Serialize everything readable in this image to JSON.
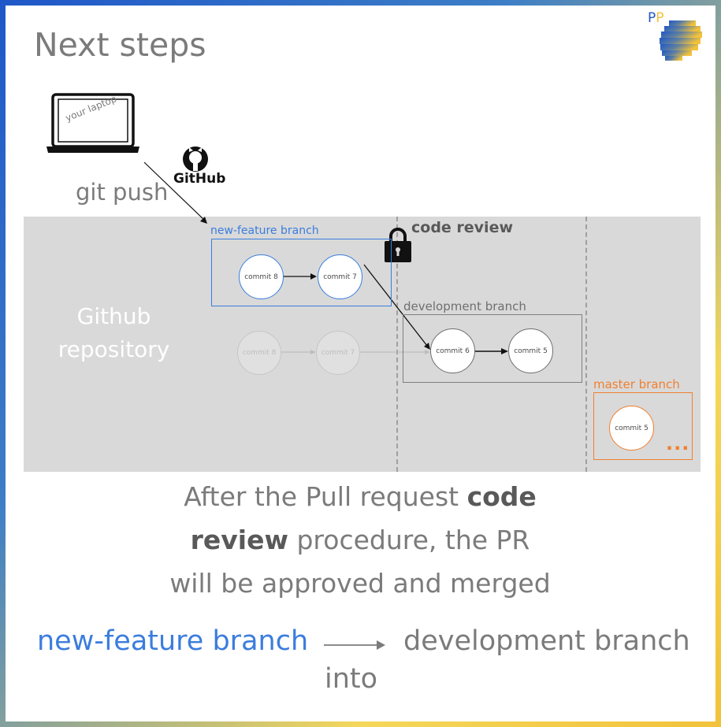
{
  "title": "Next steps",
  "logo": {
    "letters_1": "P",
    "letters_2": "P"
  },
  "laptop": {
    "label": "your laptop"
  },
  "push": {
    "label": "git push",
    "github_label": "GitHub"
  },
  "repo": {
    "label_line1": "Github",
    "label_line2": "repository",
    "code_review_label": "code review"
  },
  "branches": {
    "new_feature": {
      "label": "new-feature branch",
      "commits": [
        "commit 8",
        "commit 7"
      ]
    },
    "ghost": {
      "commits": [
        "commit 8",
        "commit 7"
      ]
    },
    "development": {
      "label": "development branch",
      "commits": [
        "commit 6",
        "commit 5"
      ]
    },
    "master": {
      "label": "master branch",
      "commits": [
        "commit 5"
      ],
      "ellipsis": "..."
    }
  },
  "description": {
    "part1": "After the Pull request ",
    "bold1": "code",
    "bold2": "review",
    "part2": " procedure, the PR",
    "line3": "will be approved and merged"
  },
  "merge": {
    "source": "new-feature branch",
    "target": "development branch",
    "connector": "into"
  },
  "colors": {
    "blue": "#3b7ddd",
    "orange": "#f07f30",
    "gray_text": "#7b7b7b",
    "repo_bg": "#d9d9d9",
    "frame_blue": "#1f57c8",
    "frame_yellow": "#f2c23b"
  }
}
